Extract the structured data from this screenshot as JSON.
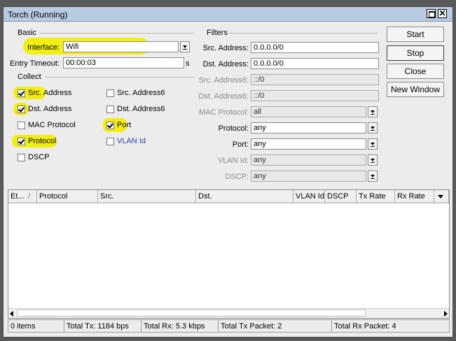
{
  "window": {
    "title": "Torch (Running)"
  },
  "basic": {
    "group_label": "Basic",
    "interface_label": "Interface:",
    "interface_value": "Wifi",
    "entry_timeout_label": "Entry Timeout:",
    "entry_timeout_value": "00:00:03",
    "entry_timeout_unit": "s"
  },
  "collect": {
    "group_label": "Collect",
    "items": [
      {
        "label": "Src. Address",
        "checked": true
      },
      {
        "label": "Src. Address6",
        "checked": false
      },
      {
        "label": "Dst. Address",
        "checked": true
      },
      {
        "label": "Dst. Address6",
        "checked": false
      },
      {
        "label": "MAC Protocol",
        "checked": false
      },
      {
        "label": "Port",
        "checked": true
      },
      {
        "label": "Protocol",
        "checked": true
      },
      {
        "label": "VLAN Id",
        "checked": false
      },
      {
        "label": "DSCP",
        "checked": false
      }
    ]
  },
  "filters": {
    "group_label": "Filters",
    "src_address_label": "Src. Address:",
    "src_address_value": "0.0.0.0/0",
    "dst_address_label": "Dst. Address:",
    "dst_address_value": "0.0.0.0/0",
    "src_address6_label": "Src. Address6:",
    "src_address6_value": "::/0",
    "dst_address6_label": "Dst. Address6:",
    "dst_address6_value": "::/0",
    "mac_protocol_label": "MAC Protocol:",
    "mac_protocol_value": "all",
    "protocol_label": "Protocol:",
    "protocol_value": "any",
    "port_label": "Port:",
    "port_value": "any",
    "vlan_id_label": "VLAN Id:",
    "vlan_id_value": "any",
    "dscp_label": "DSCP:",
    "dscp_value": "any"
  },
  "buttons": {
    "start": "Start",
    "stop": "Stop",
    "close": "Close",
    "new_window": "New Window"
  },
  "table": {
    "columns": [
      "Et...",
      "Protocol",
      "Src.",
      "Dst.",
      "VLAN Id",
      "DSCP",
      "Tx Rate",
      "Rx Rate"
    ],
    "rows": []
  },
  "status": {
    "items": "0 items",
    "total_tx": "Total Tx: 1184 bps",
    "total_rx": "Total Rx: 5.3 kbps",
    "total_tx_packet": "Total Tx Packet: 2",
    "total_rx_packet": "Total Rx Packet: 4"
  },
  "colors": {
    "highlight": "#f3ee12",
    "titlebar": "#b9cbe2"
  }
}
